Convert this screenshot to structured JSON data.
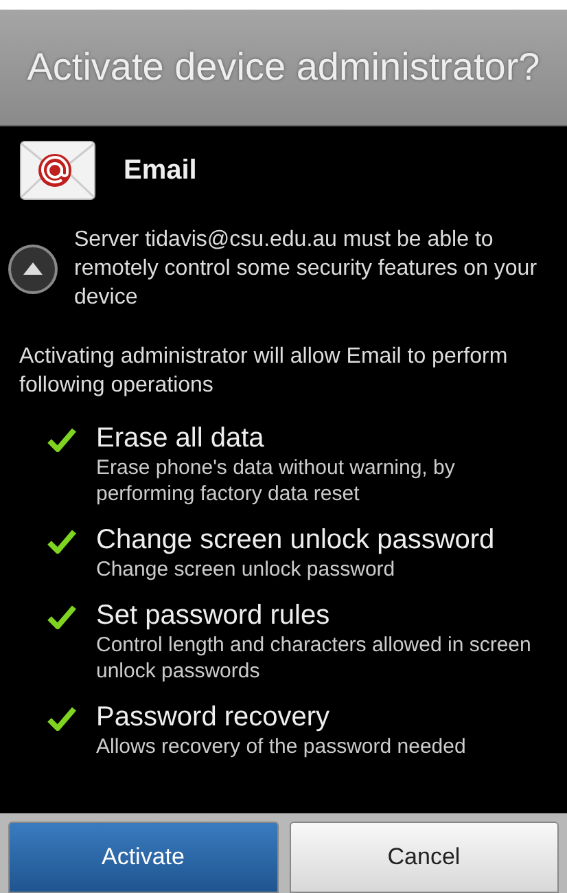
{
  "dialog": {
    "title": "Activate device administrator?"
  },
  "app": {
    "name": "Email"
  },
  "server_notice": "Server tidavis@csu.edu.au must be able to remotely control some security features on your device",
  "intro": "Activating administrator will allow Email to perform following operations",
  "permissions": [
    {
      "title": "Erase all data",
      "description": "Erase phone's data without warning, by performing factory data reset"
    },
    {
      "title": "Change screen unlock password",
      "description": "Change screen unlock password"
    },
    {
      "title": "Set password rules",
      "description": "Control length and characters allowed in screen unlock passwords"
    },
    {
      "title": "Password recovery",
      "description": "Allows recovery of the password needed"
    }
  ],
  "buttons": [
    {
      "label": "Activate",
      "kind": "primary"
    },
    {
      "label": "Cancel",
      "kind": "secondary"
    }
  ]
}
